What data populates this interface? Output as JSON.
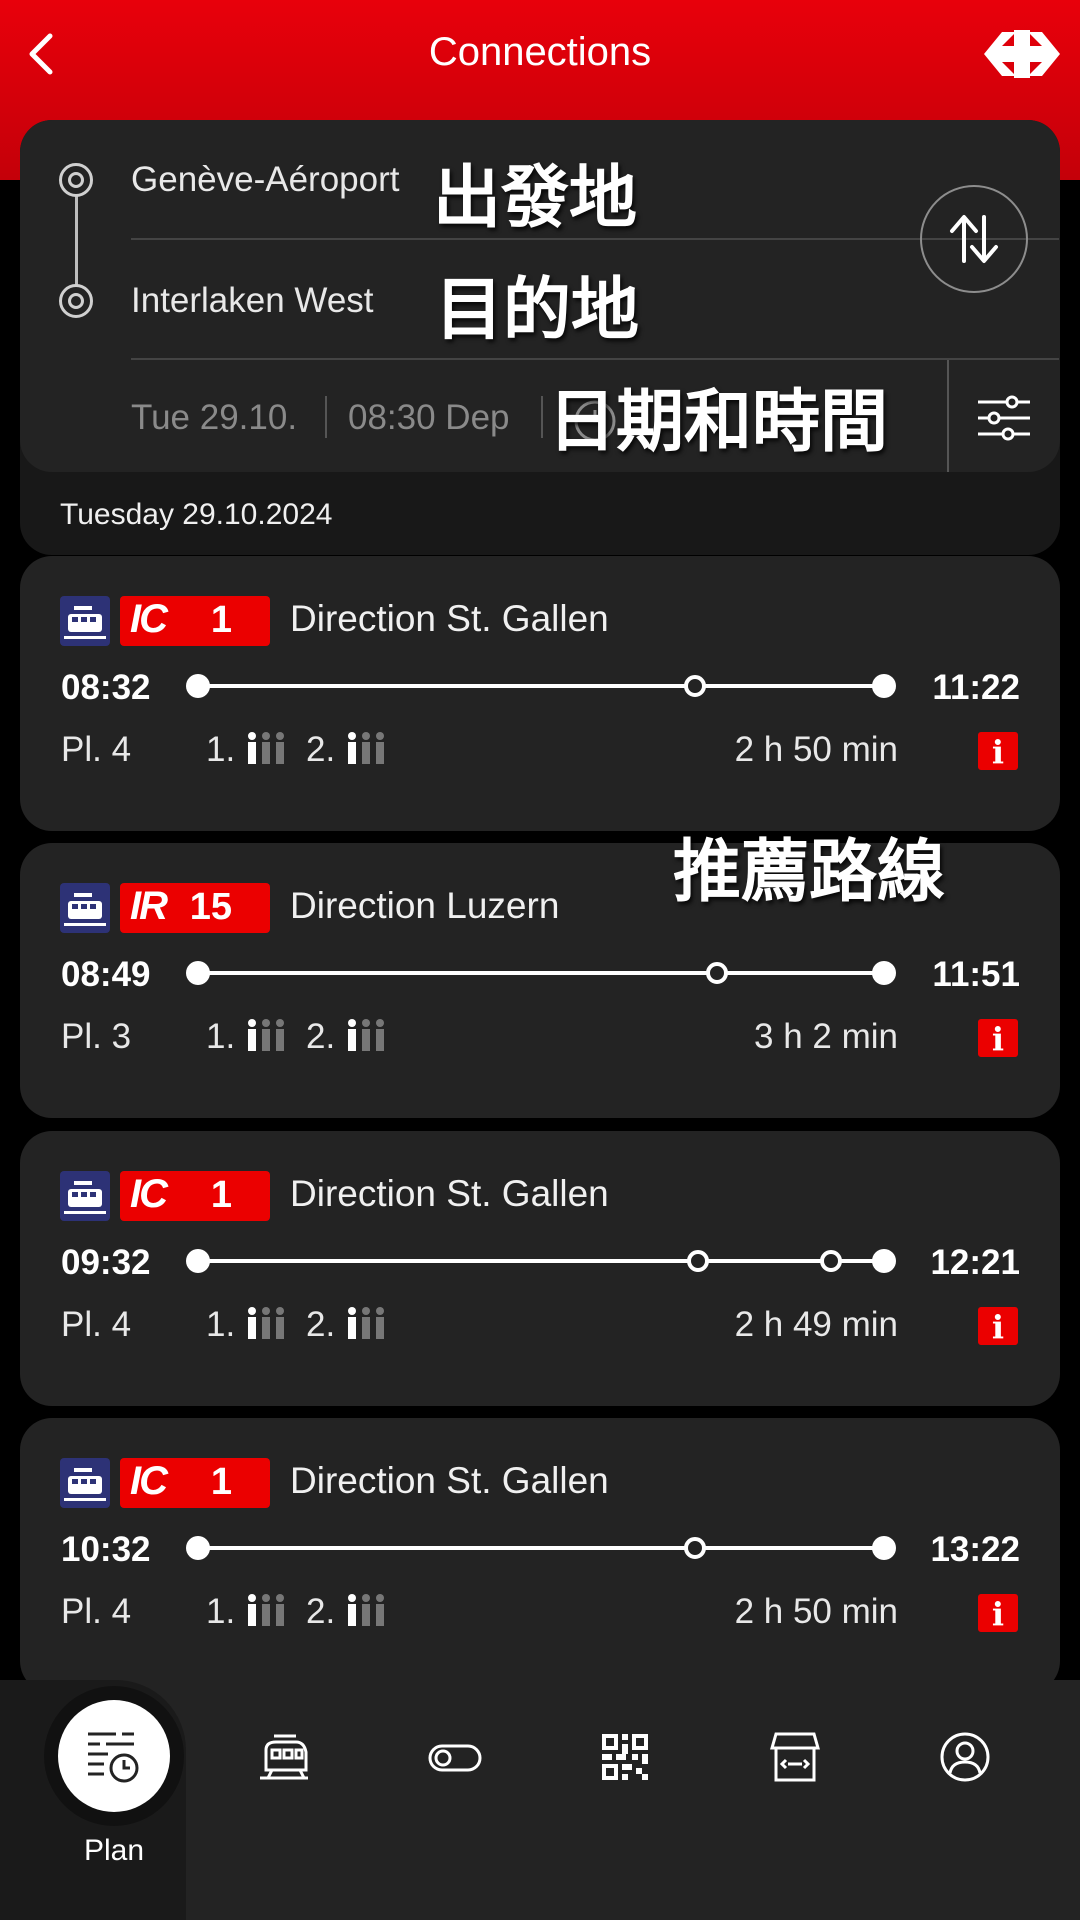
{
  "header": {
    "title": "Connections"
  },
  "search": {
    "from": "Genève-Aéroport",
    "to": "Interlaken West",
    "date": "Tue 29.10.",
    "time": "08:30 Dep"
  },
  "annotations": {
    "origin": "出發地",
    "destination": "目的地",
    "datetime": "日期和時間",
    "recommended": "推薦路線"
  },
  "day_label": "Tuesday 29.10.2024",
  "connections": [
    {
      "category": "IC",
      "line": "1",
      "direction": "Direction St. Gallen",
      "departure": "08:32",
      "arrival": "11:22",
      "platform": "Pl. 4",
      "first_class": "1.",
      "second_class": "2.",
      "duration": "2 h 50 min",
      "info": "i"
    },
    {
      "category": "IR",
      "line": "15",
      "direction": "Direction Luzern",
      "departure": "08:49",
      "arrival": "11:51",
      "platform": "Pl. 3",
      "first_class": "1.",
      "second_class": "2.",
      "duration": "3 h 2 min",
      "info": "i"
    },
    {
      "category": "IC",
      "line": "1",
      "direction": "Direction St. Gallen",
      "departure": "09:32",
      "arrival": "12:21",
      "platform": "Pl. 4",
      "first_class": "1.",
      "second_class": "2.",
      "duration": "2 h 49 min",
      "info": "i"
    },
    {
      "category": "IC",
      "line": "1",
      "direction": "Direction St. Gallen",
      "departure": "10:32",
      "arrival": "13:22",
      "platform": "Pl. 4",
      "first_class": "1.",
      "second_class": "2.",
      "duration": "2 h 50 min",
      "info": "i"
    }
  ],
  "nav": {
    "active_label": "Plan",
    "items": [
      "plan-icon",
      "train-icon",
      "toggle-icon",
      "qr-code-icon",
      "shop-icon",
      "profile-icon"
    ]
  },
  "colors": {
    "brand_red": "#eb0000",
    "card_bg": "#232323",
    "train_icon_blue": "#2d3276"
  }
}
